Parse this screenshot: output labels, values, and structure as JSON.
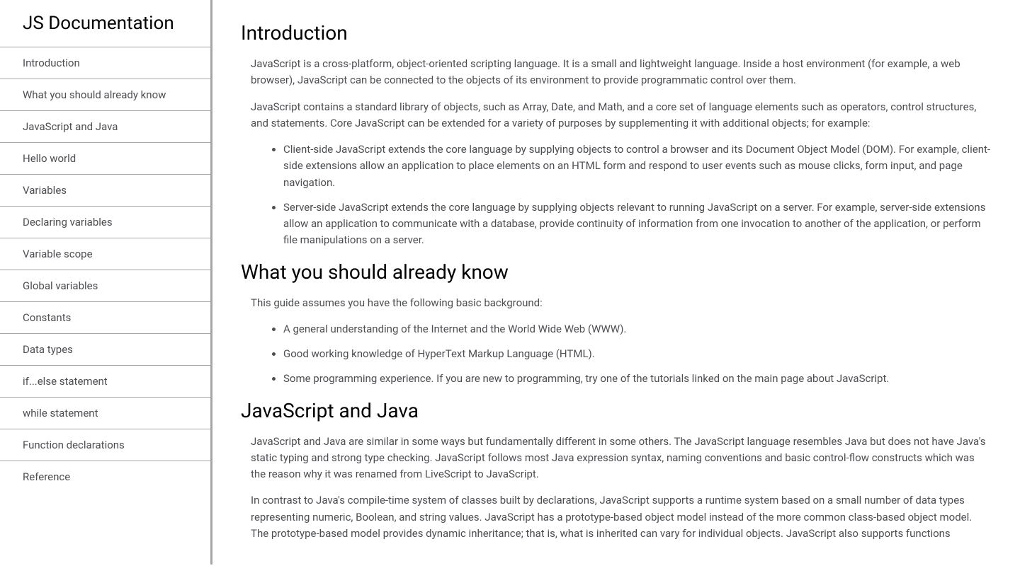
{
  "nav": {
    "title": "JS Documentation",
    "items": [
      {
        "label": "Introduction"
      },
      {
        "label": "What you should already know"
      },
      {
        "label": "JavaScript and Java"
      },
      {
        "label": "Hello world"
      },
      {
        "label": "Variables"
      },
      {
        "label": "Declaring variables"
      },
      {
        "label": "Variable scope"
      },
      {
        "label": "Global variables"
      },
      {
        "label": "Constants"
      },
      {
        "label": "Data types"
      },
      {
        "label": "if...else statement"
      },
      {
        "label": "while statement"
      },
      {
        "label": "Function declarations"
      },
      {
        "label": "Reference"
      }
    ]
  },
  "sections": {
    "introduction": {
      "heading": "Introduction",
      "p1": "JavaScript is a cross-platform, object-oriented scripting language. It is a small and lightweight language. Inside a host environment (for example, a web browser), JavaScript can be connected to the objects of its environment to provide programmatic control over them.",
      "p2": "JavaScript contains a standard library of objects, such as Array, Date, and Math, and a core set of language elements such as operators, control structures, and statements. Core JavaScript can be extended for a variety of purposes by supplementing it with additional objects; for example:",
      "li1": "Client-side JavaScript extends the core language by supplying objects to control a browser and its Document Object Model (DOM). For example, client-side extensions allow an application to place elements on an HTML form and respond to user events such as mouse clicks, form input, and page navigation.",
      "li2": "Server-side JavaScript extends the core language by supplying objects relevant to running JavaScript on a server. For example, server-side extensions allow an application to communicate with a database, provide continuity of information from one invocation to another of the application, or perform file manipulations on a server."
    },
    "prereq": {
      "heading": "What you should already know",
      "p1": "This guide assumes you have the following basic background:",
      "li1": "A general understanding of the Internet and the World Wide Web (WWW).",
      "li2": "Good working knowledge of HyperText Markup Language (HTML).",
      "li3": "Some programming experience. If you are new to programming, try one of the tutorials linked on the main page about JavaScript."
    },
    "jsjava": {
      "heading": "JavaScript and Java",
      "p1": "JavaScript and Java are similar in some ways but fundamentally different in some others. The JavaScript language resembles Java but does not have Java's static typing and strong type checking. JavaScript follows most Java expression syntax, naming conventions and basic control-flow constructs which was the reason why it was renamed from LiveScript to JavaScript.",
      "p2": "In contrast to Java's compile-time system of classes built by declarations, JavaScript supports a runtime system based on a small number of data types representing numeric, Boolean, and string values. JavaScript has a prototype-based object model instead of the more common class-based object model. The prototype-based model provides dynamic inheritance; that is, what is inherited can vary for individual objects. JavaScript also supports functions"
    }
  }
}
